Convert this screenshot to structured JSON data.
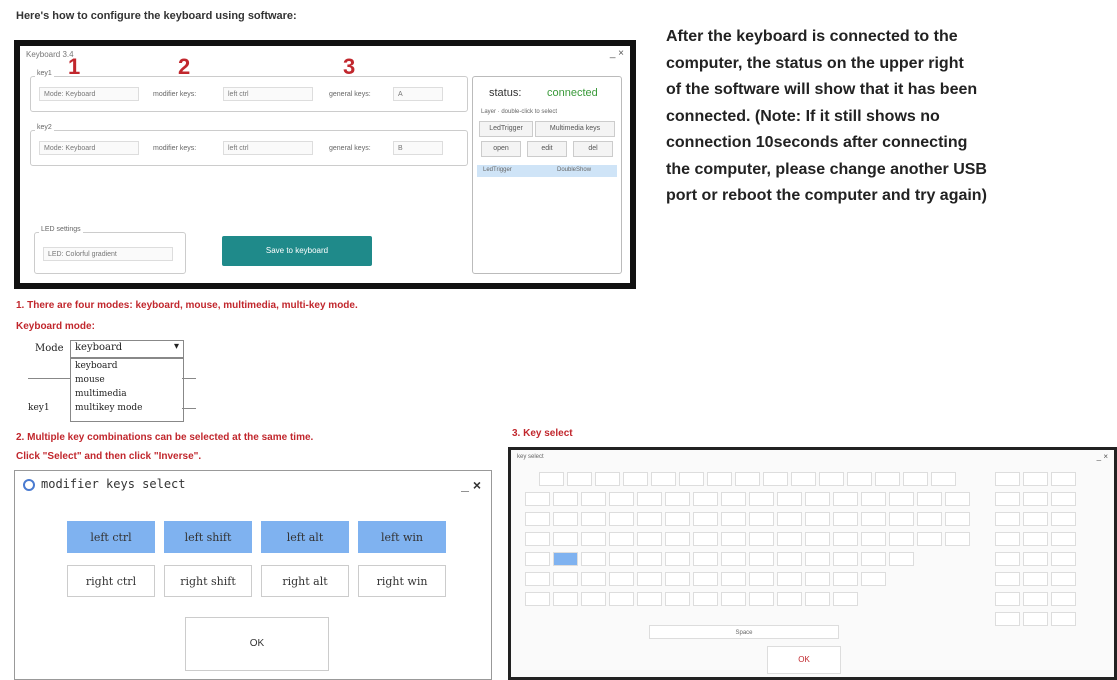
{
  "heading": "Here's how to configure the keyboard using software:",
  "main_window": {
    "title": "Keyboard 3.4",
    "close_glyph": "_ ×",
    "markers": [
      "1",
      "2",
      "3"
    ],
    "row1": {
      "group": "key1",
      "mode": "Mode: Keyboard",
      "modifier_label": "modifier keys:",
      "modifier_value": "left ctrl",
      "general_label": "general keys:",
      "general_value": "A"
    },
    "row2": {
      "group": "key2",
      "mode": "Mode: Keyboard",
      "modifier_label": "modifier keys:",
      "modifier_value": "left ctrl",
      "general_label": "general keys:",
      "general_value": "B"
    },
    "led_group": "LED settings",
    "led_value": "LED: Colorful gradient",
    "save_button": "Save to keyboard",
    "status_label": "status:",
    "status_value": "connected",
    "panel_caption": "Layer · double-click to select",
    "panel_chips": [
      "LedTrigger",
      "Multimedia keys"
    ],
    "panel_buttons": [
      "open",
      "edit",
      "del"
    ],
    "panel_row": [
      "LedTrigger",
      "DoubleShow"
    ]
  },
  "right_description": "After the keyboard is connected to the\ncomputer, the status on the upper right\nof the software will show that it has been\n connected. (Note: If it still shows no\nconnection 10seconds after connecting\nthe computer, please change another USB\nport or reboot the computer and try again)",
  "note1": "1. There are four modes: keyboard, mouse, multimedia, multi-key mode.",
  "note1b": "Keyboard mode:",
  "mode_dropdown": {
    "label": "Mode",
    "selected": "keyboard",
    "options": [
      "keyboard",
      "mouse",
      "multimedia",
      "multikey mode"
    ],
    "side_label": "key1"
  },
  "note2": "2. Multiple key combinations can be selected at the same time.",
  "note2b": "Click \"Select\" and then click \"Inverse\".",
  "note3": "3. Key select",
  "modifier_dialog": {
    "title": "modifier keys select",
    "controls": "_ ×",
    "row1": [
      "left ctrl",
      "left shift",
      "left alt",
      "left win"
    ],
    "row2": [
      "right ctrl",
      "right shift",
      "right alt",
      "right win"
    ],
    "ok": "OK"
  },
  "key_select": {
    "title": "key select",
    "ok": "OK",
    "space": "Space"
  }
}
